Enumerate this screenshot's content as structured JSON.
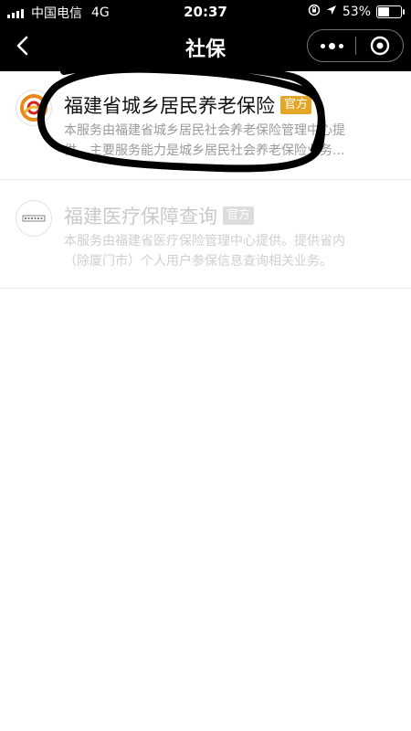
{
  "status_bar": {
    "carrier": "中国电信",
    "network": "4G",
    "time": "20:37",
    "battery_percent": "53%",
    "battery_level": 0.53,
    "icons": [
      "signal-bars-icon",
      "lock-rotation-icon",
      "location-arrow-icon",
      "battery-icon"
    ]
  },
  "navbar": {
    "title": "社保",
    "back_icon": "chevron-left-icon",
    "more_icon": "more-dots-icon",
    "close_icon": "target-circle-icon"
  },
  "results": [
    {
      "title": "福建省城乡居民养老保险",
      "badge": "官方",
      "desc_line1": "本服务由福建省城乡居民社会养老保险管理中心提",
      "desc_line2": "供。主要服务能力是城乡居民社会养老保险业务...",
      "logo_icon": "pension-logo-icon",
      "badge_color": "#e5a526"
    },
    {
      "title": "福建医疗保障查询",
      "badge": "官方",
      "desc_line1": "本服务由福建省医疗保险管理中心提供。提供省内",
      "desc_line2": "（除厦门市）个人用户参保信息查询相关业务。",
      "logo_icon": "medical-insurance-logo-icon",
      "badge_color": "#dcdcdc"
    }
  ],
  "colors": {
    "header_bg": "#000000",
    "text_primary": "#111111",
    "text_secondary": "#9a9a9a",
    "annotation_ink": "#000000"
  }
}
